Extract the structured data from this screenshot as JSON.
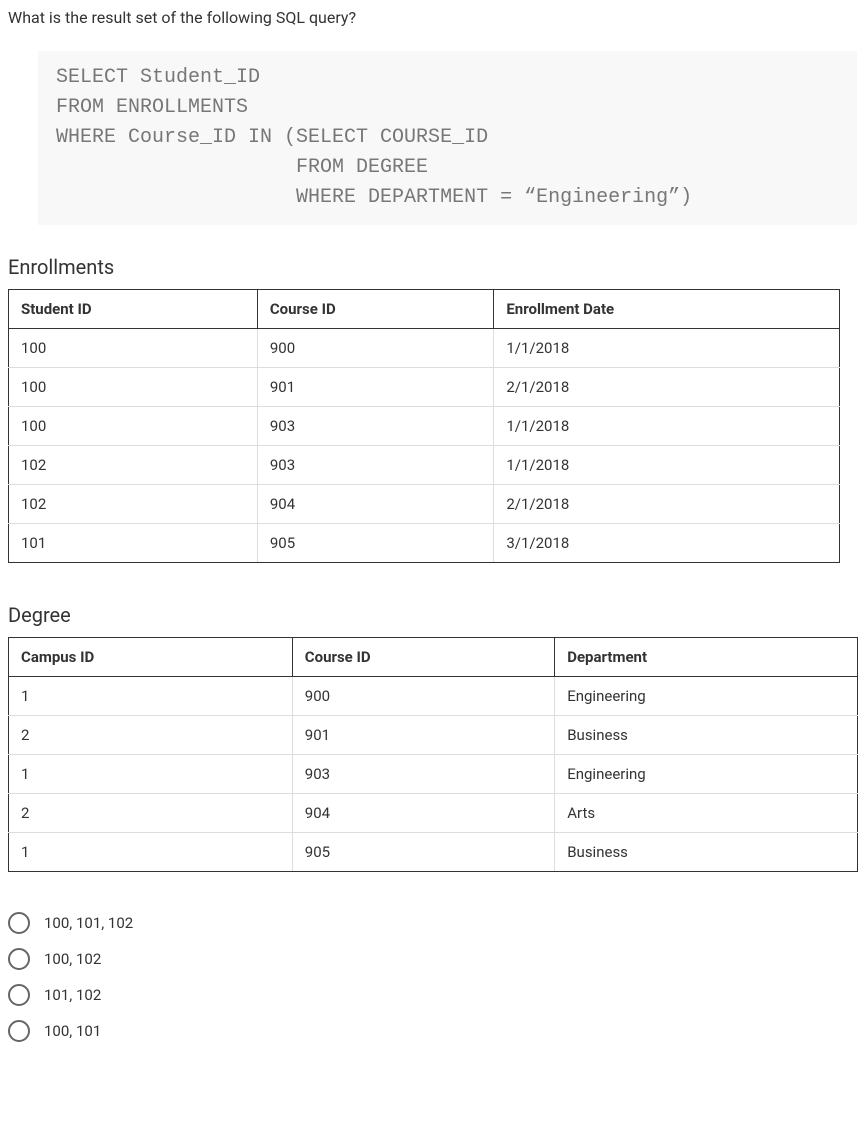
{
  "question": "What is the result set of the following SQL query?",
  "sql": "SELECT Student_ID\nFROM ENROLLMENTS\nWHERE Course_ID IN (SELECT COURSE_ID\n                    FROM DEGREE\n                    WHERE DEPARTMENT = “Engineering”)",
  "enrollments": {
    "title": "Enrollments",
    "headers": [
      "Student ID",
      "Course ID",
      "Enrollment Date"
    ],
    "rows": [
      {
        "c0": "100",
        "c1": "900",
        "c2": "1/1/2018"
      },
      {
        "c0": "100",
        "c1": "901",
        "c2": "2/1/2018"
      },
      {
        "c0": "100",
        "c1": "903",
        "c2": "1/1/2018"
      },
      {
        "c0": "102",
        "c1": "903",
        "c2": "1/1/2018"
      },
      {
        "c0": "102",
        "c1": "904",
        "c2": "2/1/2018"
      },
      {
        "c0": "101",
        "c1": "905",
        "c2": "3/1/2018"
      }
    ]
  },
  "degree": {
    "title": "Degree",
    "headers": [
      "Campus ID",
      "Course ID",
      "Department"
    ],
    "rows": [
      {
        "c0": "1",
        "c1": "900",
        "c2": "Engineering"
      },
      {
        "c0": "2",
        "c1": "901",
        "c2": "Business"
      },
      {
        "c0": "1",
        "c1": "903",
        "c2": "Engineering"
      },
      {
        "c0": "2",
        "c1": "904",
        "c2": "Arts"
      },
      {
        "c0": "1",
        "c1": "905",
        "c2": "Business"
      }
    ]
  },
  "options": [
    "100, 101, 102",
    "100, 102",
    "101, 102",
    "100, 101"
  ]
}
